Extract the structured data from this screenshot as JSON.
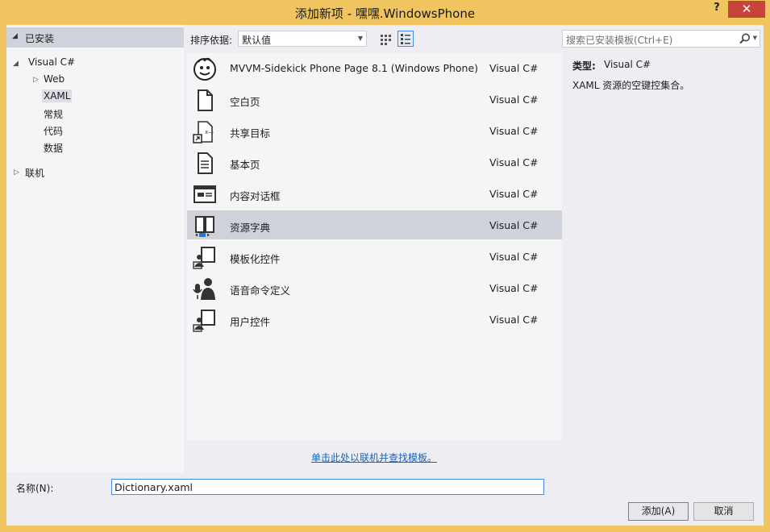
{
  "window": {
    "title": "添加新项 - 嘿嘿.WindowsPhone",
    "help_label": "?",
    "close_label": "✕"
  },
  "left": {
    "installed": "已安装",
    "lang": "Visual C#",
    "web": "Web",
    "xaml": "XAML",
    "general": "常规",
    "code": "代码",
    "data": "数据",
    "online": "联机"
  },
  "sort": {
    "label": "排序依据:",
    "value": "默认值"
  },
  "templates": [
    {
      "name": "MVVM-Sidekick Phone Page 8.1 (Windows Phone)",
      "lang": "Visual C#",
      "icon": "smiley-face-icon"
    },
    {
      "name": "空白页",
      "lang": "Visual C#",
      "icon": "blank-page-icon"
    },
    {
      "name": "共享目标",
      "lang": "Visual C#",
      "icon": "share-target-icon"
    },
    {
      "name": "基本页",
      "lang": "Visual C#",
      "icon": "basic-page-icon"
    },
    {
      "name": "内容对话框",
      "lang": "Visual C#",
      "icon": "content-dialog-icon"
    },
    {
      "name": "资源字典",
      "lang": "Visual C#",
      "icon": "resource-dictionary-icon"
    },
    {
      "name": "模板化控件",
      "lang": "Visual C#",
      "icon": "templated-control-icon"
    },
    {
      "name": "语音命令定义",
      "lang": "Visual C#",
      "icon": "voice-command-icon"
    },
    {
      "name": "用户控件",
      "lang": "Visual C#",
      "icon": "user-control-icon"
    }
  ],
  "online_link": "单击此处以联机并查找模板。",
  "search": {
    "placeholder": "搜索已安装模板(Ctrl+E)"
  },
  "details": {
    "type_label": "类型:",
    "type_value": "Visual C#",
    "description": "XAML 资源的空键控集合。"
  },
  "bottom": {
    "name_label": "名称(N):",
    "name_value": "Dictionary.xaml",
    "add_button": "添加(A)",
    "cancel_button": "取消"
  },
  "colors": {
    "title_bar": "#f0c45e",
    "selection": "#cfd1db",
    "close": "#c7443a",
    "link": "#1a63b8"
  }
}
